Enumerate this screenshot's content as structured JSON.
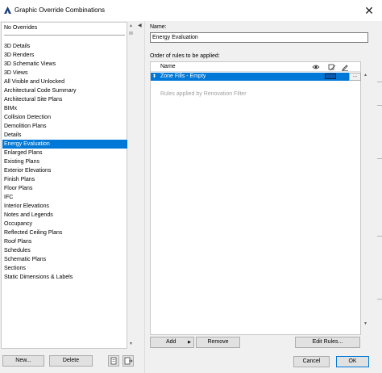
{
  "window": {
    "title": "Graphic Override Combinations",
    "close_glyph": "✕"
  },
  "left_panel": {
    "no_overrides": "No Overrides",
    "items": [
      "3D Details",
      "3D Renders",
      "3D Schematic Views",
      "3D Views",
      "All Visible and Unlocked",
      "Architectural Code Summary",
      "Architectural Site Plans",
      "BIMx",
      "Collision Detection",
      "Demolition Plans",
      "Details",
      "Energy Evaluation",
      "Enlarged Plans",
      "Existing Plans",
      "Exterior Elevations",
      "Finish Plans",
      "Floor Plans",
      "IFC",
      "Interior Elevations",
      "Notes and Legends",
      "Occupancy",
      "Reflected Ceiling Plans",
      "Roof Plans",
      "Schedules",
      "Schematic Plans",
      "Sections",
      "Static Dimensions & Labels"
    ],
    "selected_item": "Energy Evaluation",
    "new_button": "New...",
    "delete_button": "Delete"
  },
  "right_panel": {
    "name_label": "Name:",
    "name_value": "Energy Evaluation",
    "rules_label": "Order of rules to be applied:",
    "column_name": "Name",
    "rules": [
      {
        "name": "Zone Fills - Empty",
        "more": "..."
      }
    ],
    "renovation_text": "Rules applied by Renovation Filter",
    "add_button": "Add",
    "remove_button": "Remove",
    "edit_rules_button": "Edit Rules..."
  },
  "footer": {
    "cancel_button": "Cancel",
    "ok_button": "OK"
  },
  "colors": {
    "selection": "#0078d7",
    "dialog_bg": "#f0f0f0"
  }
}
